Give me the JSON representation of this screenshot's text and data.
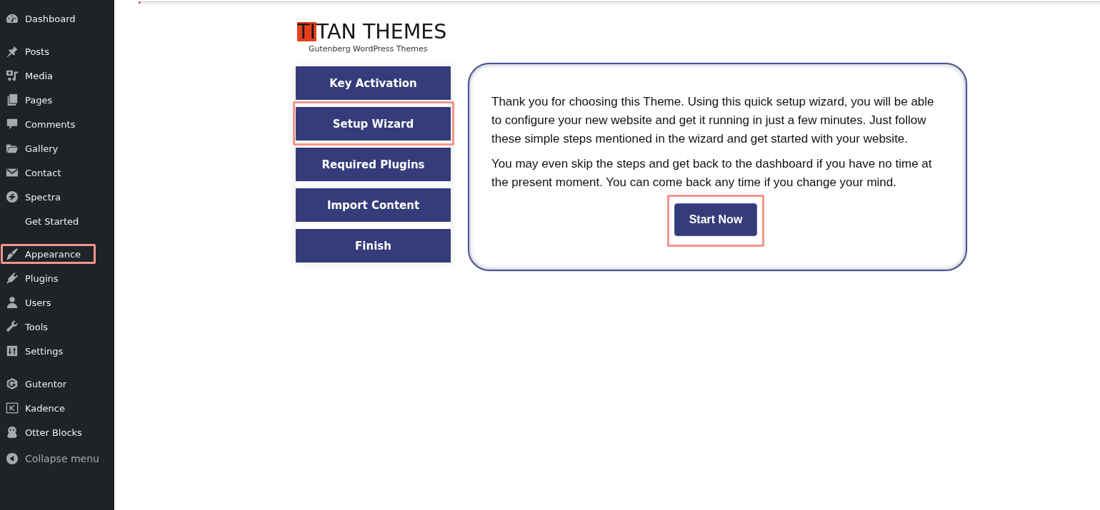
{
  "sidebar": {
    "groups": [
      {
        "items": [
          {
            "label": "Dashboard",
            "highlighted": false
          }
        ]
      },
      {
        "items": [
          {
            "label": "Posts",
            "highlighted": false
          },
          {
            "label": "Media",
            "highlighted": false
          },
          {
            "label": "Pages",
            "highlighted": false
          },
          {
            "label": "Comments",
            "highlighted": false
          },
          {
            "label": "Gallery",
            "highlighted": false
          },
          {
            "label": "Contact",
            "highlighted": false
          },
          {
            "label": "Spectra",
            "highlighted": false
          },
          {
            "label": "Get Started",
            "highlighted": false
          }
        ]
      },
      {
        "items": [
          {
            "label": "Appearance",
            "highlighted": true
          },
          {
            "label": "Plugins",
            "highlighted": false
          },
          {
            "label": "Users",
            "highlighted": false
          },
          {
            "label": "Tools",
            "highlighted": false
          },
          {
            "label": "Settings",
            "highlighted": false
          }
        ]
      },
      {
        "items": [
          {
            "label": "Gutentor",
            "highlighted": false
          },
          {
            "label": "Kadence",
            "highlighted": false
          },
          {
            "label": "Otter Blocks",
            "highlighted": false
          }
        ]
      }
    ],
    "collapse": {
      "label": "Collapse menu"
    }
  },
  "logo": {
    "highlight": "TI",
    "rest": "TAN THEMES",
    "tagline": "Gutenberg WordPress Themes"
  },
  "wizard_nav": [
    {
      "label": "Key Activation",
      "highlighted": false
    },
    {
      "label": "Setup Wizard",
      "highlighted": true
    },
    {
      "label": "Required Plugins",
      "highlighted": false
    },
    {
      "label": "Import Content",
      "highlighted": false
    },
    {
      "label": "Finish",
      "highlighted": false
    }
  ],
  "intro_card": {
    "paragraphs": [
      "Thank you for choosing this Theme. Using this quick setup wizard, you will be able to configure your new website and get it running in just a few minutes. Just follow these simple steps mentioned in the wizard and get started with your website.",
      "You may even skip the steps and get back to the dashboard if you have no time at the present moment. You can come back any time if you change your mind."
    ],
    "button": {
      "label": "Start Now",
      "highlighted": true
    }
  }
}
